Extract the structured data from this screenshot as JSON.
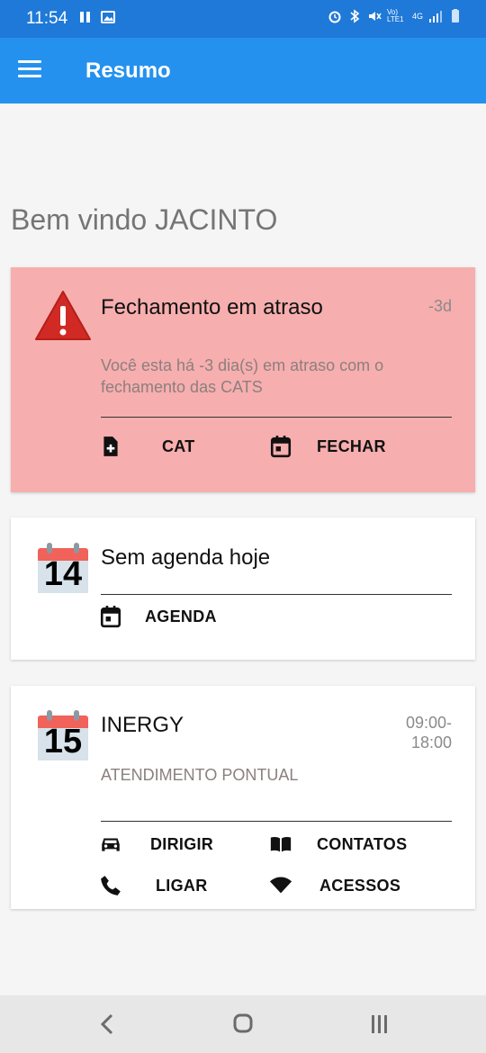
{
  "status_bar": {
    "time": "11:54",
    "net_label": "Vo) LTE1",
    "net_type": "4G"
  },
  "app_bar": {
    "title": "Resumo"
  },
  "welcome": "Bem vindo JACINTO",
  "alert_card": {
    "title": "Fechamento em atraso",
    "badge": "-3d",
    "message": "Você esta há -3 dia(s) em atraso com o fechamento das CATS",
    "actions": [
      {
        "label": "CAT",
        "icon": "file-plus-icon"
      },
      {
        "label": "FECHAR",
        "icon": "calendar-icon"
      }
    ]
  },
  "agenda_card": {
    "day": "14",
    "title": "Sem agenda hoje",
    "actions": [
      {
        "label": "AGENDA",
        "icon": "calendar-icon"
      }
    ]
  },
  "appointment_card": {
    "day": "15",
    "title": "INERGY",
    "time_start": "09:00-",
    "time_end": "18:00",
    "subtitle": "ATENDIMENTO PONTUAL",
    "actions": [
      {
        "label": "DIRIGIR",
        "icon": "car-icon"
      },
      {
        "label": "CONTATOS",
        "icon": "book-icon"
      },
      {
        "label": "LIGAR",
        "icon": "phone-icon"
      },
      {
        "label": "ACESSOS",
        "icon": "wifi-icon"
      }
    ]
  },
  "colors": {
    "status_bar": "#1f79d8",
    "app_bar": "#2591ef",
    "alert_bg": "#f7aeae",
    "calendar_red": "#f0625a"
  }
}
